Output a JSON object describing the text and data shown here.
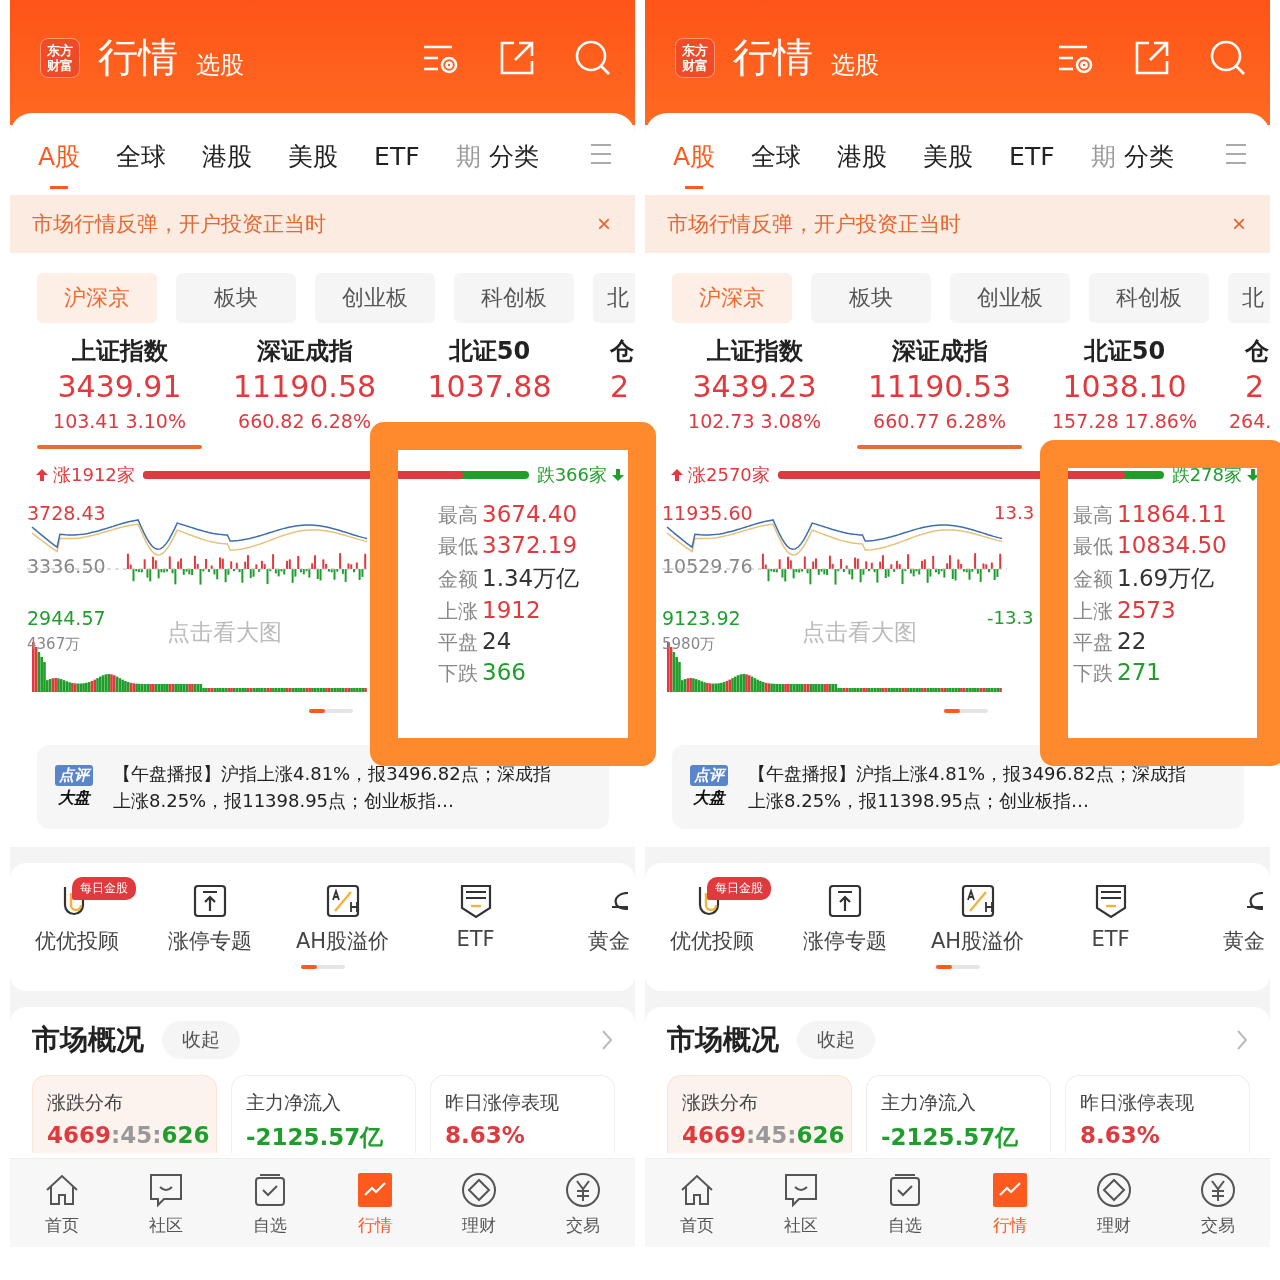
{
  "phones": [
    {
      "header": {
        "logo": [
          "东方",
          "财富"
        ],
        "title": "行情",
        "subtitle": "选股"
      },
      "market_tabs": [
        {
          "label": "A股",
          "selected": true,
          "faded": false
        },
        {
          "label": "全球",
          "selected": false,
          "faded": false
        },
        {
          "label": "港股",
          "selected": false,
          "faded": false
        },
        {
          "label": "美股",
          "selected": false,
          "faded": false
        },
        {
          "label": "ETF",
          "selected": false,
          "faded": false
        },
        {
          "label": "期",
          "selected": false,
          "faded": true
        },
        {
          "label": "分类",
          "selected": false,
          "faded": false
        }
      ],
      "banner": {
        "text": "市场行情反弹，开户投资正当时",
        "close": "×"
      },
      "segment_tabs": [
        {
          "label": "沪深京",
          "selected": true
        },
        {
          "label": "板块",
          "selected": false
        },
        {
          "label": "创业板",
          "selected": false
        },
        {
          "label": "科创板",
          "selected": false
        },
        {
          "label": "北",
          "selected": false
        }
      ],
      "indices": [
        {
          "name": "上证指数",
          "value": "3439.91",
          "change": "103.41",
          "pct": "3.10%",
          "selected": true
        },
        {
          "name": "深证成指",
          "value": "11190.58",
          "change": "660.82",
          "pct": "6.28%",
          "selected": false
        },
        {
          "name": "北证50",
          "value": "1037.88",
          "selected": false
        },
        {
          "name": "仓",
          "value": "2",
          "selected": false
        }
      ],
      "breadth": {
        "up": "涨1912家",
        "down": "跌366家",
        "level": 0.83
      },
      "chart": {
        "high": "3728.43",
        "mid": "3336.50",
        "low": "2944.57",
        "volume": "4367万",
        "hint": "点击看大图"
      },
      "stats": [
        {
          "label": "最高",
          "value": "3674.40",
          "kind": "up"
        },
        {
          "label": "最低",
          "value": "3372.19",
          "kind": "up"
        },
        {
          "label": "金额",
          "value": "1.34万亿",
          "kind": "flat"
        },
        {
          "label": "上涨",
          "value": "1912",
          "kind": "up"
        },
        {
          "label": "平盘",
          "value": "24",
          "kind": "flat"
        },
        {
          "label": "下跌",
          "value": "366",
          "kind": "down"
        }
      ],
      "news": {
        "badge_top": "点评",
        "badge_bottom": "大盘",
        "text": "【午盘播报】沪指上涨4.81%，报3496.82点；深成指上涨8.25%，报11398.95点；创业板指…"
      },
      "shortcuts": [
        {
          "label": "优优投顾",
          "kind": "advisor",
          "badge": "每日金股"
        },
        {
          "label": "涨停专题",
          "kind": "limit"
        },
        {
          "label": "AH股溢价",
          "kind": "ah"
        },
        {
          "label": "ETF",
          "kind": "etf"
        },
        {
          "label": "黄金",
          "kind": "gold"
        }
      ],
      "overview": {
        "title": "市场概况",
        "toggle": "收起",
        "cards": [
          {
            "title": "涨跌分布",
            "selected": true,
            "parts": [
              {
                "text": "4669",
                "kind": "up"
              },
              {
                "text": ":45:",
                "kind": "flat"
              },
              {
                "text": "626",
                "kind": "down"
              }
            ]
          },
          {
            "title": "主力净流入",
            "selected": false,
            "parts": [
              {
                "text": "-2125.57亿",
                "kind": "down"
              }
            ]
          },
          {
            "title": "昨日涨停表现",
            "selected": false,
            "parts": [
              {
                "text": "8.63%",
                "kind": "up"
              }
            ]
          }
        ]
      },
      "nav": [
        {
          "label": "首页",
          "kind": "home",
          "selected": false
        },
        {
          "label": "社区",
          "kind": "chat",
          "selected": false
        },
        {
          "label": "自选",
          "kind": "check",
          "selected": false
        },
        {
          "label": "行情",
          "kind": "market",
          "selected": true
        },
        {
          "label": "理财",
          "kind": "wealth",
          "selected": false
        },
        {
          "label": "交易",
          "kind": "trade",
          "selected": false
        }
      ]
    },
    {
      "header": {
        "logo": [
          "东方",
          "财富"
        ],
        "title": "行情",
        "subtitle": "选股"
      },
      "market_tabs": [
        {
          "label": "A股",
          "selected": true,
          "faded": false
        },
        {
          "label": "全球",
          "selected": false,
          "faded": false
        },
        {
          "label": "港股",
          "selected": false,
          "faded": false
        },
        {
          "label": "美股",
          "selected": false,
          "faded": false
        },
        {
          "label": "ETF",
          "selected": false,
          "faded": false
        },
        {
          "label": "期",
          "selected": false,
          "faded": true
        },
        {
          "label": "分类",
          "selected": false,
          "faded": false
        }
      ],
      "banner": {
        "text": "市场行情反弹，开户投资正当时",
        "close": "×"
      },
      "segment_tabs": [
        {
          "label": "沪深京",
          "selected": true
        },
        {
          "label": "板块",
          "selected": false
        },
        {
          "label": "创业板",
          "selected": false
        },
        {
          "label": "科创板",
          "selected": false
        },
        {
          "label": "北",
          "selected": false
        }
      ],
      "indices": [
        {
          "name": "上证指数",
          "value": "3439.23",
          "change": "102.73",
          "pct": "3.08%",
          "selected": false
        },
        {
          "name": "深证成指",
          "value": "11190.53",
          "change": "660.77",
          "pct": "6.28%",
          "selected": true
        },
        {
          "name": "北证50",
          "value": "1038.10",
          "change": "157.28",
          "pct": "17.86%",
          "selected": false
        },
        {
          "name": "仓",
          "value": "2",
          "change": "264.",
          "selected": false
        }
      ],
      "breadth": {
        "up": "涨2570家",
        "down": "跌278家",
        "level": 0.9
      },
      "chart": {
        "high": "11935.60",
        "mid": "10529.76",
        "low": "9123.92",
        "volume": "5980万",
        "hint": "点击看大图",
        "right_high": "13.3",
        "right_low": "-13.3"
      },
      "stats": [
        {
          "label": "最高",
          "value": "11864.11",
          "kind": "up"
        },
        {
          "label": "最低",
          "value": "10834.50",
          "kind": "up"
        },
        {
          "label": "金额",
          "value": "1.69万亿",
          "kind": "flat"
        },
        {
          "label": "上涨",
          "value": "2573",
          "kind": "up"
        },
        {
          "label": "平盘",
          "value": "22",
          "kind": "flat"
        },
        {
          "label": "下跌",
          "value": "271",
          "kind": "down"
        }
      ],
      "news": {
        "badge_top": "点评",
        "badge_bottom": "大盘",
        "text": "【午盘播报】沪指上涨4.81%，报3496.82点；深成指上涨8.25%，报11398.95点；创业板指…"
      },
      "shortcuts": [
        {
          "label": "优优投顾",
          "kind": "advisor",
          "badge": "每日金股"
        },
        {
          "label": "涨停专题",
          "kind": "limit"
        },
        {
          "label": "AH股溢价",
          "kind": "ah"
        },
        {
          "label": "ETF",
          "kind": "etf"
        },
        {
          "label": "黄金",
          "kind": "gold"
        }
      ],
      "overview": {
        "title": "市场概况",
        "toggle": "收起",
        "cards": [
          {
            "title": "涨跌分布",
            "selected": true,
            "parts": [
              {
                "text": "4669",
                "kind": "up"
              },
              {
                "text": ":45:",
                "kind": "flat"
              },
              {
                "text": "626",
                "kind": "down"
              }
            ]
          },
          {
            "title": "主力净流入",
            "selected": false,
            "parts": [
              {
                "text": "-2125.57亿",
                "kind": "down"
              }
            ]
          },
          {
            "title": "昨日涨停表现",
            "selected": false,
            "parts": [
              {
                "text": "8.63%",
                "kind": "up"
              }
            ]
          }
        ]
      },
      "nav": [
        {
          "label": "首页",
          "kind": "home",
          "selected": false
        },
        {
          "label": "社区",
          "kind": "chat",
          "selected": false
        },
        {
          "label": "自选",
          "kind": "check",
          "selected": false
        },
        {
          "label": "行情",
          "kind": "market",
          "selected": true
        },
        {
          "label": "理财",
          "kind": "wealth",
          "selected": false
        },
        {
          "label": "交易",
          "kind": "trade",
          "selected": false
        }
      ]
    }
  ],
  "highlights": [
    {
      "kind": "frame"
    },
    {
      "kind": "frame"
    }
  ]
}
